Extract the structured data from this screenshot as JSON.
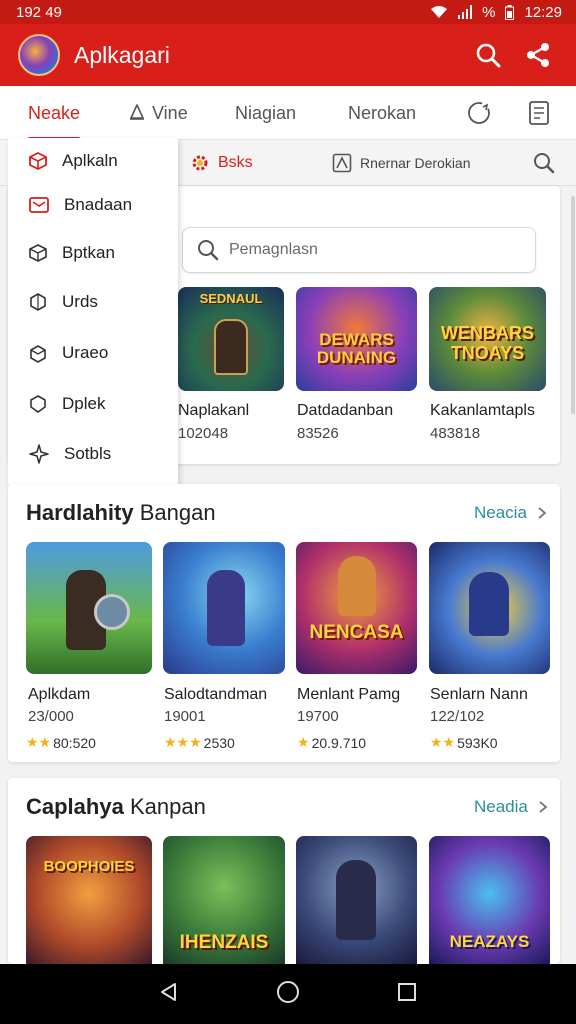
{
  "status": {
    "time": "192 49",
    "battery_text": "%",
    "clock": "12:29"
  },
  "app": {
    "title": "Aplkagari"
  },
  "tabs": [
    {
      "label": "Neake",
      "active": true
    },
    {
      "label": "Vine"
    },
    {
      "label": "Niagian"
    },
    {
      "label": "Nerokan"
    }
  ],
  "subtabs": {
    "item1": "Bsks",
    "item2": "Rnernar Derokian"
  },
  "search": {
    "placeholder": "Pemagnlasn"
  },
  "menu": [
    {
      "label": "Aplkaln",
      "icon": "box-icon"
    },
    {
      "label": "Bnadaan",
      "icon": "mail-icon"
    },
    {
      "label": "Bptkan",
      "icon": "cube-icon"
    },
    {
      "label": "Urds",
      "icon": "hexagon-icon"
    },
    {
      "label": "Uraeo",
      "icon": "package-icon"
    },
    {
      "label": "Dplek",
      "icon": "shield-icon"
    },
    {
      "label": "Sotbls",
      "icon": "sparkle-icon"
    }
  ],
  "top_row": [
    {
      "title": "Naplakanl",
      "sub": "102048",
      "art": "SEDNAUL"
    },
    {
      "title": "Datdadanban",
      "sub": "83526",
      "art": "DEWARS DUNAING"
    },
    {
      "title": "Kakanlamtapls",
      "sub": "483818",
      "art": "WENBARS TNOAYS"
    }
  ],
  "section1": {
    "title_bold": "Hardlahity",
    "title_rest": "Bangan",
    "more": "Neacia",
    "items": [
      {
        "title": "Aplkdam",
        "sub": "23/000",
        "rating": "80:520",
        "stars": 2
      },
      {
        "title": "Salodtandman",
        "sub": "19001",
        "rating": "2530",
        "stars": 3
      },
      {
        "title": "Menlant Pamg",
        "sub": "19700",
        "rating": "20.9.710",
        "stars": 1,
        "art": "NENCASA"
      },
      {
        "title": "Senlarn Nann",
        "sub": "122/102",
        "rating": "593K0",
        "stars": 2
      }
    ]
  },
  "section2": {
    "title_bold": "Caplahya",
    "title_rest": "Kanpan",
    "more": "Neadia",
    "items": [
      {
        "art": "BOOPHOIES"
      },
      {
        "art": "IHENZAIS"
      },
      {
        "art": ""
      },
      {
        "art": "NEAZAYS"
      }
    ]
  },
  "colors": {
    "brand": "#d81f1a",
    "link": "#2a8f9d",
    "star": "#f2b21b"
  }
}
